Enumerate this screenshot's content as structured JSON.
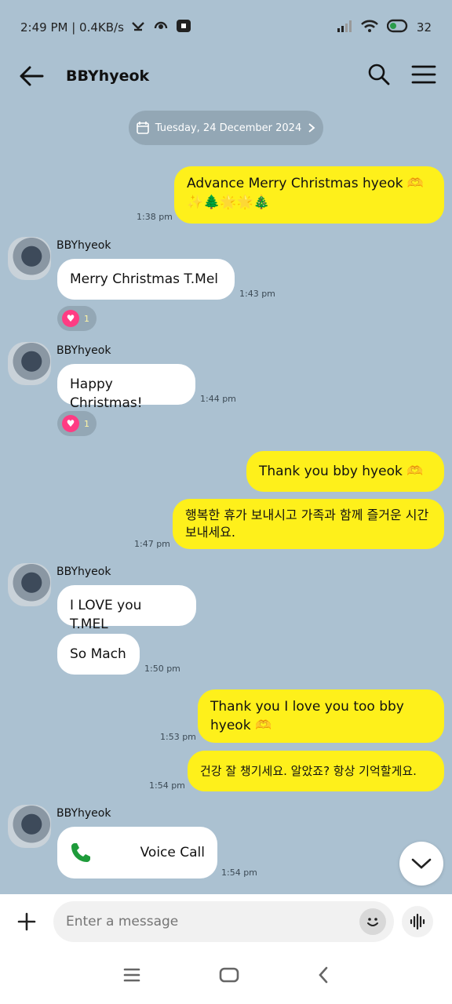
{
  "status": {
    "time_speed": "2:49 PM | 0.4KB/s",
    "battery": "32"
  },
  "header": {
    "title": "BBYhyeok"
  },
  "date_pill": "Tuesday, 24 December 2024",
  "messages": [
    {
      "from": "me",
      "text": "Advance Merry Christmas hyeok 🫶 ✨🌲🌟🌟🎄",
      "time": "1:38 pm"
    },
    {
      "from": "them",
      "sender": "BBYhyeok",
      "text": "Merry Christmas T.Mel",
      "time": "1:43 pm",
      "reaction_count": "1"
    },
    {
      "from": "them",
      "sender": "BBYhyeok",
      "text": "Happy Christmas!",
      "time": "1:44 pm",
      "reaction_count": "1"
    },
    {
      "from": "me",
      "text": "Thank you bby hyeok 🫶",
      "time": ""
    },
    {
      "from": "me",
      "text": "행복한 휴가 보내시고 가족과 함께 즐거운 시간 보내세요.",
      "time": "1:47 pm"
    },
    {
      "from": "them",
      "sender": "BBYhyeok",
      "text": "I LOVE you T.MEL",
      "time": ""
    },
    {
      "from": "them",
      "text": "So Mach",
      "time": "1:50 pm"
    },
    {
      "from": "me",
      "text": "Thank you I love you too bby hyeok 🫶",
      "time": "1:53 pm"
    },
    {
      "from": "me",
      "text": "건강 잘 챙기세요. 알았죠? 항상 기억할게요.",
      "time": "1:54 pm"
    },
    {
      "from": "them",
      "sender": "BBYhyeok",
      "text": "Voice Call",
      "time": "1:54 pm"
    }
  ],
  "input": {
    "placeholder": "Enter a message"
  },
  "colors": {
    "background": "#abc1d1",
    "my_bubble": "#fef01b",
    "their_bubble": "#ffffff",
    "reaction_heart": "#ff3c83",
    "call_icon": "#1e9b3a"
  }
}
